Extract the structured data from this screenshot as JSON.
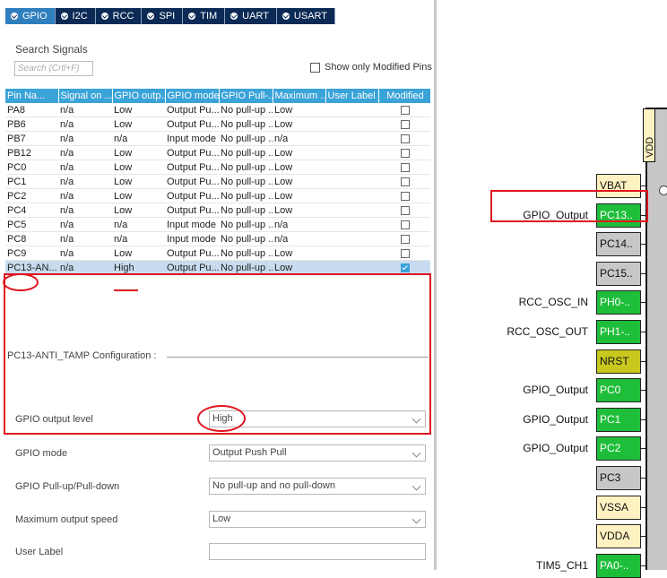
{
  "tabs": [
    {
      "label": "GPIO",
      "active": true
    },
    {
      "label": "I2C",
      "active": false
    },
    {
      "label": "RCC",
      "active": false
    },
    {
      "label": "SPI",
      "active": false
    },
    {
      "label": "TIM",
      "active": false
    },
    {
      "label": "UART",
      "active": false
    },
    {
      "label": "USART",
      "active": false
    }
  ],
  "search": {
    "label": "Search Signals",
    "placeholder": "Search (Crtl+F)"
  },
  "only_modified": {
    "label": "Show only Modified Pins",
    "checked": false
  },
  "table": {
    "headers": [
      "Pin Na...",
      "Signal on ...",
      "GPIO outp...",
      "GPIO mode",
      "GPIO Pull-...",
      "Maximum ...",
      "User Label",
      "Modified"
    ],
    "rows": [
      {
        "pin": "PA8",
        "signal": "n/a",
        "output": "Low",
        "mode": "Output Pu...",
        "pull": "No pull-up ...",
        "speed": "Low",
        "label": "",
        "modified": false
      },
      {
        "pin": "PB6",
        "signal": "n/a",
        "output": "Low",
        "mode": "Output Pu...",
        "pull": "No pull-up ...",
        "speed": "Low",
        "label": "",
        "modified": false
      },
      {
        "pin": "PB7",
        "signal": "n/a",
        "output": "n/a",
        "mode": "Input mode",
        "pull": "No pull-up ...",
        "speed": "n/a",
        "label": "",
        "modified": false
      },
      {
        "pin": "PB12",
        "signal": "n/a",
        "output": "Low",
        "mode": "Output Pu...",
        "pull": "No pull-up ...",
        "speed": "Low",
        "label": "",
        "modified": false
      },
      {
        "pin": "PC0",
        "signal": "n/a",
        "output": "Low",
        "mode": "Output Pu...",
        "pull": "No pull-up ...",
        "speed": "Low",
        "label": "",
        "modified": false
      },
      {
        "pin": "PC1",
        "signal": "n/a",
        "output": "Low",
        "mode": "Output Pu...",
        "pull": "No pull-up ...",
        "speed": "Low",
        "label": "",
        "modified": false
      },
      {
        "pin": "PC2",
        "signal": "n/a",
        "output": "Low",
        "mode": "Output Pu...",
        "pull": "No pull-up ...",
        "speed": "Low",
        "label": "",
        "modified": false
      },
      {
        "pin": "PC4",
        "signal": "n/a",
        "output": "Low",
        "mode": "Output Pu...",
        "pull": "No pull-up ...",
        "speed": "Low",
        "label": "",
        "modified": false
      },
      {
        "pin": "PC5",
        "signal": "n/a",
        "output": "n/a",
        "mode": "Input mode",
        "pull": "No pull-up ...",
        "speed": "n/a",
        "label": "",
        "modified": false
      },
      {
        "pin": "PC8",
        "signal": "n/a",
        "output": "n/a",
        "mode": "Input mode",
        "pull": "No pull-up ...",
        "speed": "n/a",
        "label": "",
        "modified": false
      },
      {
        "pin": "PC9",
        "signal": "n/a",
        "output": "Low",
        "mode": "Output Pu...",
        "pull": "No pull-up ...",
        "speed": "Low",
        "label": "",
        "modified": false
      },
      {
        "pin": "PC13-AN...",
        "signal": "n/a",
        "output": "High",
        "mode": "Output Pu...",
        "pull": "No pull-up ...",
        "speed": "Low",
        "label": "",
        "modified": true,
        "selected": true
      }
    ]
  },
  "config": {
    "legend": "PC13-ANTI_TAMP Configuration :",
    "fields": [
      {
        "label": "GPIO output level",
        "value": "High",
        "kind": "select"
      },
      {
        "label": "GPIO mode",
        "value": "Output Push Pull",
        "kind": "select"
      },
      {
        "label": "GPIO Pull-up/Pull-down",
        "value": "No pull-up and no pull-down",
        "kind": "select"
      },
      {
        "label": "Maximum output speed",
        "value": "Low",
        "kind": "select"
      },
      {
        "label": "User Label",
        "value": "",
        "kind": "input"
      }
    ]
  },
  "chip": {
    "top_label": "VDD",
    "pins": [
      {
        "name": "VBAT",
        "color": "yellow",
        "label": ""
      },
      {
        "name": "PC13..",
        "color": "green",
        "label": "GPIO_Output"
      },
      {
        "name": "PC14..",
        "color": "grey",
        "label": ""
      },
      {
        "name": "PC15..",
        "color": "grey",
        "label": ""
      },
      {
        "name": "PH0-..",
        "color": "green",
        "label": "RCC_OSC_IN"
      },
      {
        "name": "PH1-..",
        "color": "green",
        "label": "RCC_OSC_OUT"
      },
      {
        "name": "NRST",
        "color": "olive",
        "label": ""
      },
      {
        "name": "PC0",
        "color": "green",
        "label": "GPIO_Output"
      },
      {
        "name": "PC1",
        "color": "green",
        "label": "GPIO_Output"
      },
      {
        "name": "PC2",
        "color": "green",
        "label": "GPIO_Output"
      },
      {
        "name": "PC3",
        "color": "grey",
        "label": ""
      },
      {
        "name": "VSSA",
        "color": "yellow",
        "label": ""
      },
      {
        "name": "VDDA",
        "color": "yellow",
        "label": ""
      },
      {
        "name": "PA0-..",
        "color": "green",
        "label": "TIM5_CH1"
      }
    ]
  },
  "colors": {
    "accent": "#3aa3d8",
    "tab_bar": "#0b2a55",
    "pin_green": "#1fbe3a",
    "highlight_red": "#e0141e"
  }
}
